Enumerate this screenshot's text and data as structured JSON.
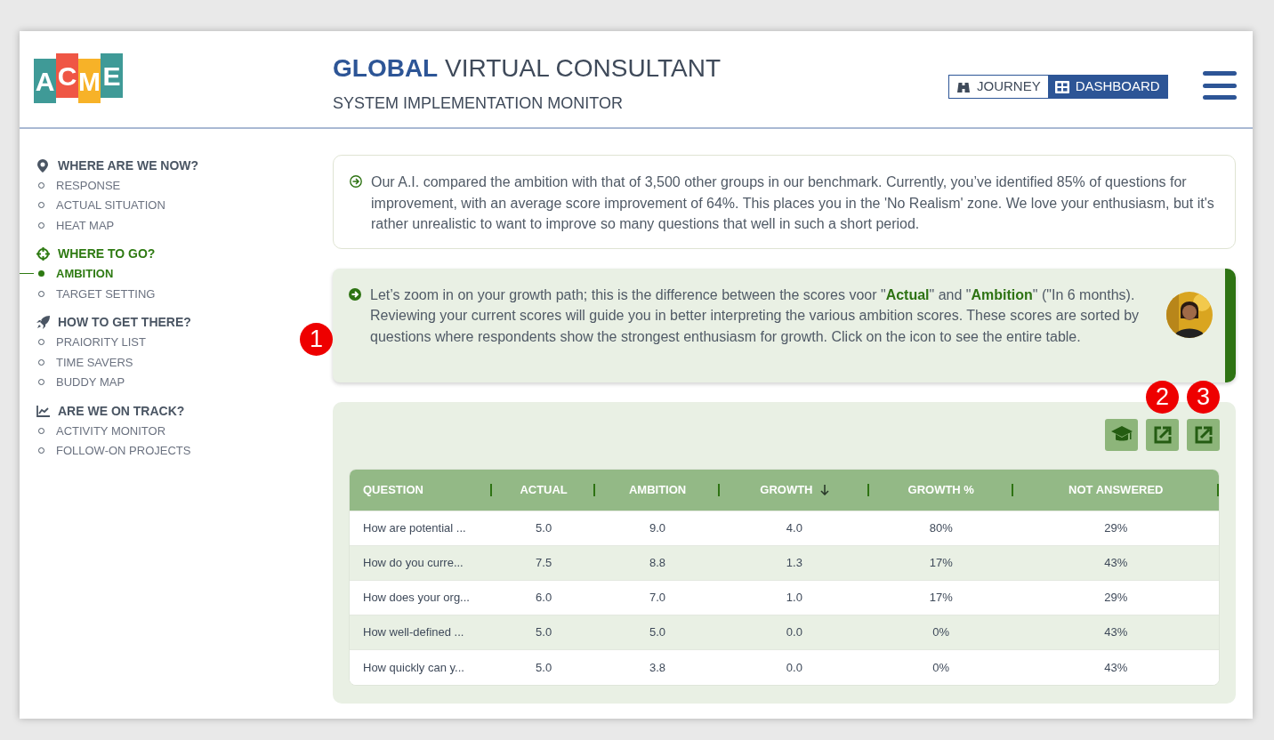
{
  "logo": {
    "letters": [
      {
        "text": "A",
        "color": "#3f9a97"
      },
      {
        "text": "C",
        "color": "#ef5645"
      },
      {
        "text": "M",
        "color": "#f7b228"
      },
      {
        "text": "E",
        "color": "#3f9a97"
      }
    ]
  },
  "header": {
    "title": "**GLOBAL** VIRTUAL CONSULTANT",
    "subtitle": "SYSTEM IMPLEMENTATION MONITOR",
    "view_toggle": [
      {
        "label": "JOURNEY",
        "kind": "journey",
        "selected": false
      },
      {
        "label": "DASHBOARD",
        "kind": "dashboard",
        "selected": true
      }
    ]
  },
  "sidebar": {
    "sections": [
      {
        "title": "WHERE ARE WE NOW?",
        "kind": "pin",
        "active": false,
        "items": [
          {
            "label": "RESPONSE",
            "selected": false
          },
          {
            "label": "ACTUAL SITUATION",
            "selected": false
          },
          {
            "label": "HEAT MAP",
            "selected": false
          }
        ]
      },
      {
        "title": "WHERE TO GO?",
        "kind": "target",
        "active": true,
        "items": [
          {
            "label": "AMBITION",
            "selected": true
          },
          {
            "label": "TARGET SETTING",
            "selected": false
          }
        ]
      },
      {
        "title": "HOW TO GET THERE?",
        "kind": "rocket",
        "active": false,
        "items": [
          {
            "label": "PRAIORITY LIST",
            "selected": false
          },
          {
            "label": "TIME SAVERS",
            "selected": false
          },
          {
            "label": "BUDDY MAP",
            "selected": false
          }
        ]
      },
      {
        "title": "ARE WE ON TRACK?",
        "kind": "chart",
        "active": false,
        "items": [
          {
            "label": "ACTIVITY MONITOR",
            "selected": false
          },
          {
            "label": "FOLLOW-ON PROJECTS",
            "selected": false
          }
        ]
      }
    ]
  },
  "messages": [
    {
      "kind": "plain",
      "text": "Our A.I. compared the ambition with that of 3,500 other groups in our benchmark. Currently, you’ve identified 85% of questions for improvement, with an average score improvement of 64%. This places you in the 'No Realism' zone. We love your enthusiasm, but it's rather unrealistic to want to improve so many questions that well in such a short period."
    },
    {
      "kind": "highlight",
      "text": "Let’s zoom in on your growth path; this is the difference between the scores voor \"**Actual**\" and \"**Ambition**\" (\"In 6 months). Reviewing your current scores will guide you in better interpreting the various ambition scores. These scores are sorted by questions where respondents show the strongest enthusiasm for growth. Click on the icon to see the entire table."
    }
  ],
  "toolbar": [
    {
      "kind": "learn"
    },
    {
      "kind": "export"
    },
    {
      "kind": "export"
    }
  ],
  "table": {
    "columns": [
      {
        "label": "QUESTION",
        "sorted": false
      },
      {
        "label": "ACTUAL",
        "sorted": false
      },
      {
        "label": "AMBITION",
        "sorted": false
      },
      {
        "label": "GROWTH",
        "sorted": true
      },
      {
        "label": "GROWTH %",
        "sorted": false
      },
      {
        "label": "NOT ANSWERED",
        "sorted": false
      }
    ],
    "rows": [
      [
        "How are potential ...",
        "5.0",
        "9.0",
        "4.0",
        "80%",
        "29%"
      ],
      [
        "How do you curre...",
        "7.5",
        "8.8",
        "1.3",
        "17%",
        "43%"
      ],
      [
        "How does your org...",
        "6.0",
        "7.0",
        "1.0",
        "17%",
        "29%"
      ],
      [
        "How well-defined ...",
        "5.0",
        "5.0",
        "0.0",
        "0%",
        "43%"
      ],
      [
        "How quickly can y...",
        "5.0",
        "3.8",
        "0.0",
        "0%",
        "43%"
      ]
    ]
  },
  "callouts": [
    "1",
    "2",
    "3"
  ]
}
